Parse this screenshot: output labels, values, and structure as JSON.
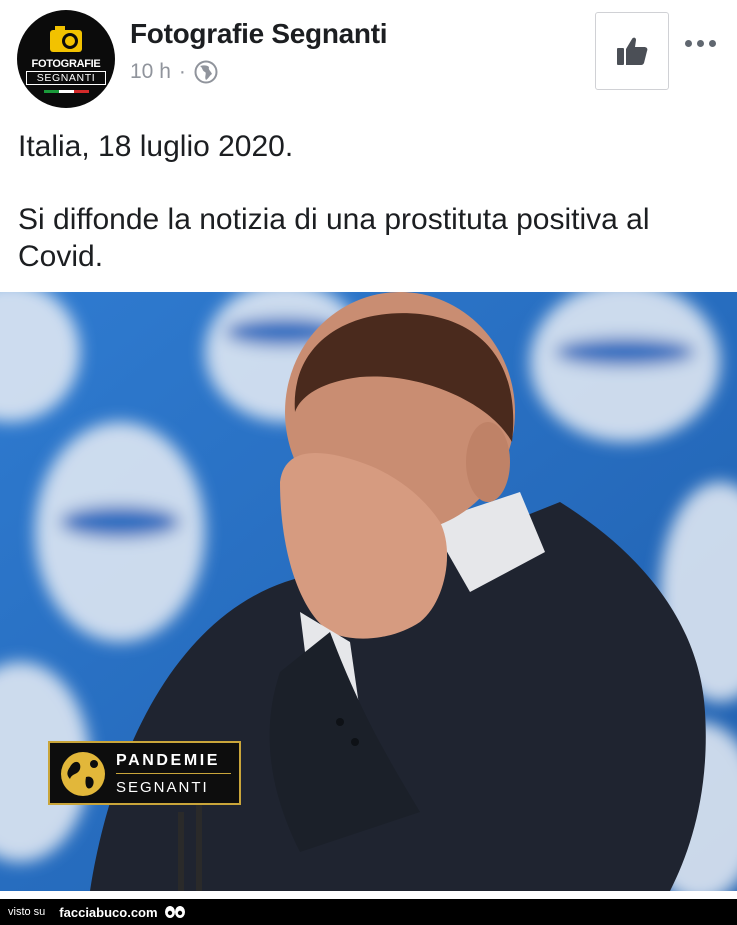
{
  "post": {
    "page_name": "Fotografie Segnanti",
    "timestamp": "10 h",
    "separator": "·",
    "avatar": {
      "line1": "FOTOGRAFIE",
      "line2": "SEGNANTI"
    },
    "text_line1": "Italia, 18 luglio 2020.",
    "text_line2": "Si diffonde la notizia di una prostituta positiva al Covid."
  },
  "actions": {
    "like_icon": "thumbs-up-icon",
    "more_icon": "more-dots-icon"
  },
  "photo": {
    "watermark_line1": "PANDEMIE",
    "watermark_line2": "SEGNANTI",
    "background_color": "#2a72c6"
  },
  "footer": {
    "seen_on": "visto su",
    "site": "facciabuco.com"
  }
}
